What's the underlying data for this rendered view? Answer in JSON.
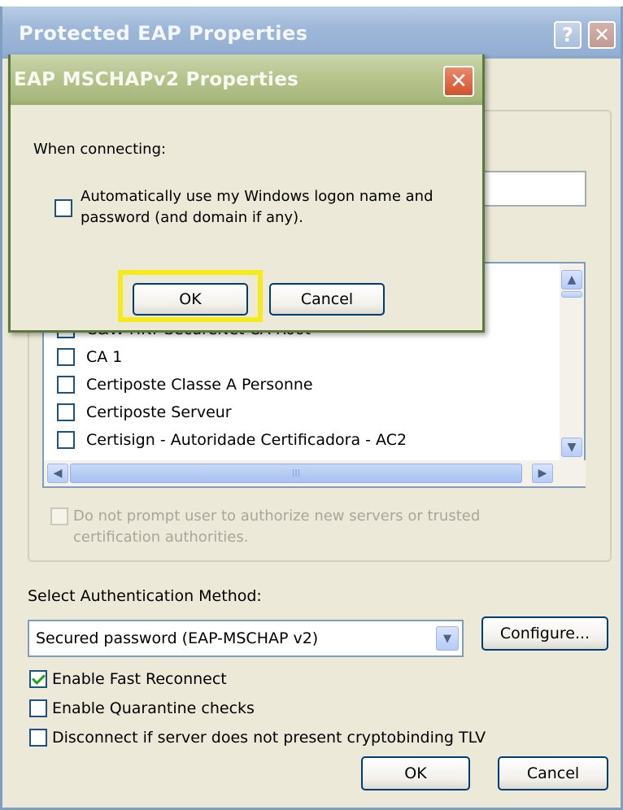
{
  "main_dialog": {
    "title": "Protected EAP Properties",
    "help_glyph": "?",
    "close_glyph": "✕",
    "ca_list": {
      "items": [
        {
          "label": "C&W HKT SecureNet CA Root",
          "checked": false
        },
        {
          "label": "CA 1",
          "checked": false
        },
        {
          "label": "Certiposte Classe A Personne",
          "checked": false
        },
        {
          "label": "Certiposte Serveur",
          "checked": false
        },
        {
          "label": "Certisign - Autoridade Certificadora - AC2",
          "checked": false
        }
      ],
      "scroll_up_icon": "▲",
      "scroll_down_icon": "▼",
      "scroll_left_icon": "◀",
      "scroll_right_icon": "▶",
      "thumb_grip": "III"
    },
    "dont_prompt_label": "Do not prompt user to authorize new servers or trusted certification authorities.",
    "auth_method_label": "Select Authentication Method:",
    "auth_method_value": "Secured password (EAP-MSCHAP v2)",
    "dropdown_arrow_icon": "▼",
    "configure_label": "Configure...",
    "options": [
      {
        "label": "Enable Fast Reconnect",
        "checked": true
      },
      {
        "label": "Enable Quarantine checks",
        "checked": false
      },
      {
        "label": "Disconnect if server does not present cryptobinding TLV",
        "checked": false
      }
    ],
    "ok_label": "OK",
    "cancel_label": "Cancel"
  },
  "overlay_dialog": {
    "title": "EAP MSCHAPv2 Properties",
    "close_glyph": "✕",
    "when_connecting": "When connecting:",
    "auto_logon_label": "Automatically use my Windows logon name and password (and domain if any).",
    "auto_logon_checked": false,
    "ok_label": "OK",
    "cancel_label": "Cancel",
    "highlight_color": "#f5ea1c"
  }
}
